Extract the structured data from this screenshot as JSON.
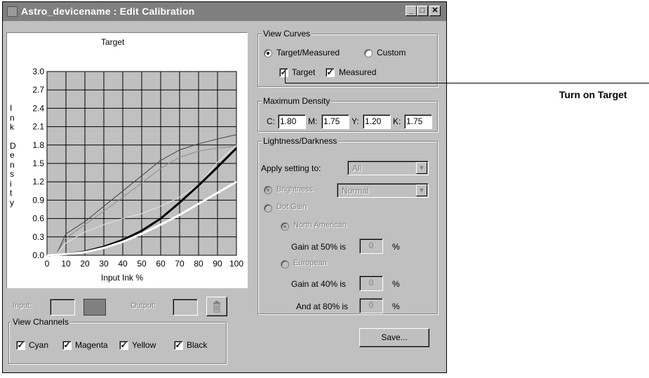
{
  "window": {
    "title": "Astro_devicename : Edit Calibration",
    "title_color": "#7f7f7f"
  },
  "titlebar_buttons": {
    "minimize": "_",
    "maximize": "□",
    "close": "✕"
  },
  "graph": {
    "heading": "Target",
    "y_label_letters": [
      "I",
      "n",
      "k",
      "D",
      "e",
      "n",
      "s",
      "i",
      "t",
      "y"
    ],
    "y_ticks": [
      "3.0",
      "2.7",
      "2.4",
      "2.1",
      "1.8",
      "1.5",
      "1.2",
      "0.9",
      "0.6",
      "0.3",
      "0.0"
    ],
    "x_ticks": [
      "0",
      "10",
      "20",
      "30",
      "40",
      "50",
      "60",
      "70",
      "80",
      "90",
      "100"
    ],
    "x_label": "Input Ink %"
  },
  "chart_data": {
    "type": "line",
    "title": "Target",
    "xlabel": "Input Ink %",
    "ylabel": "Ink Density",
    "xlim": [
      0,
      100
    ],
    "ylim": [
      0,
      3.0
    ],
    "grid": true,
    "series": [
      {
        "x": [
          0,
          5,
          10,
          20,
          30,
          40,
          50,
          60,
          70,
          80,
          90,
          100
        ],
        "y": [
          0,
          0.02,
          0.35,
          0.55,
          0.8,
          1.05,
          1.3,
          1.55,
          1.72,
          1.82,
          1.9,
          1.97
        ],
        "color": "#404040",
        "width": 1
      },
      {
        "x": [
          0,
          5,
          10,
          20,
          30,
          40,
          50,
          60,
          70,
          80,
          90,
          100
        ],
        "y": [
          0,
          0.02,
          0.28,
          0.5,
          0.72,
          0.95,
          1.18,
          1.42,
          1.6,
          1.7,
          1.75,
          1.78
        ],
        "color": "#8c8c8c",
        "width": 1
      },
      {
        "x": [
          0,
          5,
          10,
          20,
          30,
          40,
          50,
          60,
          70,
          80,
          90,
          100
        ],
        "y": [
          0,
          0.02,
          0.2,
          0.38,
          0.5,
          0.6,
          0.68,
          0.8,
          0.95,
          1.15,
          1.52,
          1.8
        ],
        "color": "#e6e6e6",
        "width": 1
      },
      {
        "x": [
          0,
          10,
          20,
          30,
          40,
          50,
          60,
          70,
          80,
          90,
          100
        ],
        "y": [
          0,
          0.02,
          0.06,
          0.14,
          0.25,
          0.4,
          0.6,
          0.86,
          1.14,
          1.44,
          1.75
        ],
        "color": "#000000",
        "width": 3
      },
      {
        "x": [
          0,
          10,
          20,
          30,
          40,
          50,
          60,
          70,
          80,
          90,
          100
        ],
        "y": [
          0,
          0.02,
          0.05,
          0.12,
          0.22,
          0.35,
          0.5,
          0.66,
          0.84,
          1.02,
          1.2
        ],
        "color": "#ffffff",
        "width": 3
      }
    ]
  },
  "io": {
    "input_label": "Input:",
    "output_label": "Output:",
    "trash_icon": "trash-icon"
  },
  "view_channels": {
    "legend": "View Channels",
    "items": [
      {
        "label": "Cyan",
        "checked": true
      },
      {
        "label": "Magenta",
        "checked": true
      },
      {
        "label": "Yellow",
        "checked": true
      },
      {
        "label": "Black",
        "checked": true
      }
    ]
  },
  "view_curves": {
    "legend": "View Curves",
    "radio_target_measured": "Target/Measured",
    "radio_custom": "Custom",
    "check_target": "Target",
    "check_measured": "Measured"
  },
  "max_density": {
    "legend": "Maximum Density",
    "c_label": "C:",
    "c_value": "1.80",
    "m_label": "M:",
    "m_value": "1.75",
    "y_label": "Y:",
    "y_value": "1.20",
    "k_label": "K:",
    "k_value": "1.75"
  },
  "lightness": {
    "legend": "Lightness/Darkness",
    "apply_label": "Apply setting to:",
    "apply_value": "All",
    "brightness_label": "Brightness",
    "brightness_value": "Normal",
    "dot_gain_label": "Dot Gain",
    "north_american_label": "North American",
    "gain50_label": "Gain at 50% is",
    "gain50_value": "0",
    "european_label": "European",
    "gain40_label": "Gain at 40% is",
    "gain40_value": "0",
    "and80_label": "And at 80% is",
    "and80_value": "0",
    "percent": "%"
  },
  "save_button": "Save...",
  "callout": {
    "text": "Turn on Target"
  }
}
